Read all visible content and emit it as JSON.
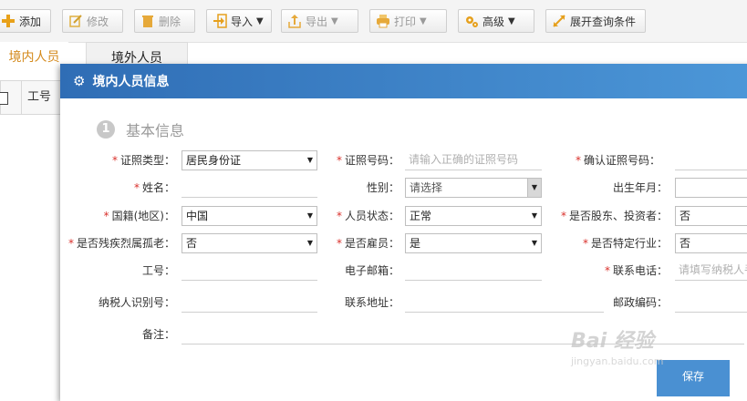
{
  "toolbar": {
    "add": "添加",
    "edit": "修改",
    "delete": "删除",
    "import": "导入",
    "export": "导出",
    "print": "打印",
    "advanced": "高级",
    "expand_query": "展开查询条件"
  },
  "tabs": {
    "domestic": "境内人员",
    "foreign": "境外人员"
  },
  "grid": {
    "col_employee_id": "工号"
  },
  "dialog": {
    "title": "境内人员信息",
    "section_number": "1",
    "section_title": "基本信息",
    "save": "保存",
    "fields": {
      "id_type_label": "证照类型：",
      "id_type_value": "居民身份证",
      "id_number_label": "证照号码：",
      "id_number_placeholder": "请输入正确的证照号码",
      "confirm_id_label": "确认证照号码：",
      "name_label": "姓名：",
      "gender_label": "性别：",
      "gender_value": "请选择",
      "birth_label": "出生年月：",
      "nationality_label": "国籍(地区)：",
      "nationality_value": "中国",
      "status_label": "人员状态：",
      "status_value": "正常",
      "shareholder_label": "是否股东、投资者：",
      "shareholder_value": "否",
      "disabled_label": "是否残疾烈属孤老：",
      "disabled_value": "否",
      "employee_label": "是否雇员：",
      "employee_value": "是",
      "special_industry_label": "是否特定行业：",
      "special_industry_value": "否",
      "employee_id_label": "工号：",
      "email_label": "电子邮箱：",
      "phone_label": "联系电话：",
      "phone_placeholder": "请填写纳税人手",
      "taxpayer_id_label": "纳税人识别号：",
      "address_label": "联系地址：",
      "postcode_label": "邮政编码：",
      "remark_label": "备注："
    }
  },
  "watermark": {
    "logo": "Bai 经验",
    "url": "jingyan.baidu.com"
  }
}
